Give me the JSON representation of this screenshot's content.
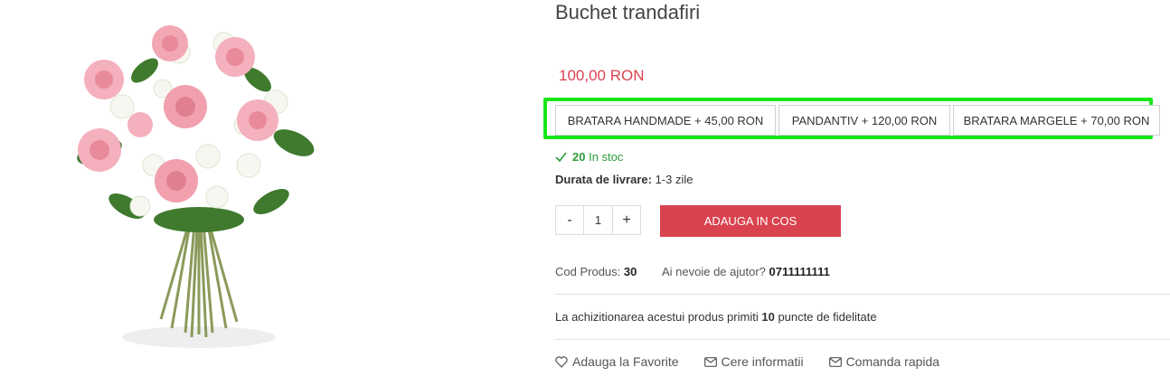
{
  "product": {
    "title": "Buchet trandafiri",
    "price": "100,00 RON",
    "options": [
      {
        "label": "BRATARA HANDMADE + 45,00 RON"
      },
      {
        "label": "PANDANTIV + 120,00 RON"
      },
      {
        "label": "BRATARA MARGELE + 70,00 RON"
      }
    ],
    "stock": {
      "count": "20",
      "text": "In stoc"
    },
    "delivery": {
      "label": "Durata de livrare:",
      "value": "1-3 zile"
    },
    "quantity": {
      "minus": "-",
      "value": "1",
      "plus": "+"
    },
    "add_to_cart": "ADAUGA IN COS",
    "code": {
      "label": "Cod Produs:",
      "value": "30"
    },
    "help": {
      "label": "Ai nevoie de ajutor?",
      "phone": "0711111111"
    },
    "loyalty": {
      "prefix": "La achizitionarea acestui produs primiti",
      "points": "10",
      "suffix": "puncte de fidelitate"
    },
    "actions": [
      {
        "label": "Adauga la Favorite",
        "icon": "heart-icon"
      },
      {
        "label": "Cere informatii",
        "icon": "envelope-icon"
      },
      {
        "label": "Comanda rapida",
        "icon": "envelope-icon"
      }
    ]
  },
  "colors": {
    "accent": "#d9434f",
    "stock": "#2a9d3a",
    "highlight": "#19e619"
  }
}
